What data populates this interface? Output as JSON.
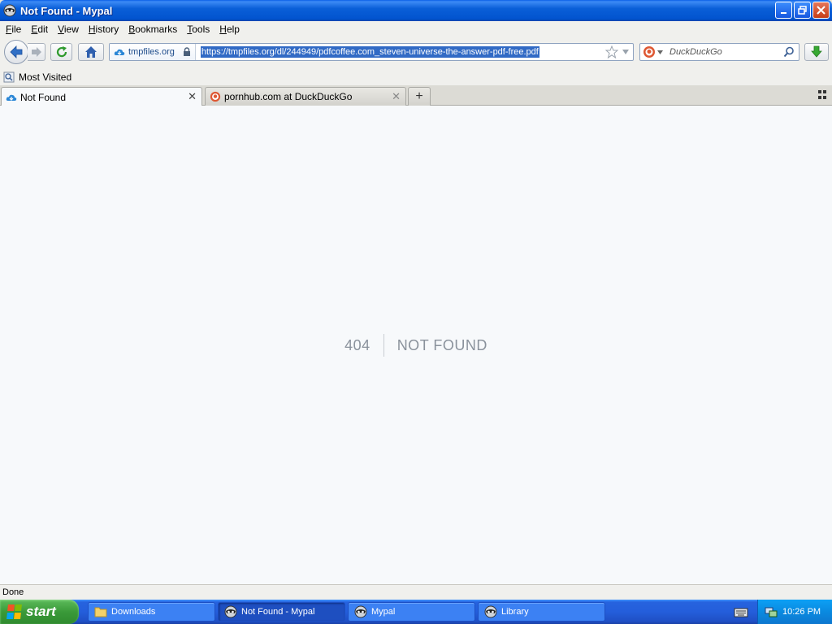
{
  "window": {
    "title": "Not Found - Mypal",
    "buttons": [
      "minimize",
      "restore",
      "close"
    ]
  },
  "menubar": [
    {
      "label": "File",
      "accel": "F",
      "rest": "ile"
    },
    {
      "label": "Edit",
      "accel": "E",
      "rest": "dit"
    },
    {
      "label": "View",
      "accel": "V",
      "rest": "iew"
    },
    {
      "label": "History",
      "accel": "H",
      "rest": "istory"
    },
    {
      "label": "Bookmarks",
      "accel": "B",
      "rest": "ookmarks"
    },
    {
      "label": "Tools",
      "accel": "T",
      "rest": "ools"
    },
    {
      "label": "Help",
      "accel": "H",
      "rest": "elp"
    }
  ],
  "navbar": {
    "identity_host": "tmpfiles.org",
    "url": "https://tmpfiles.org/dl/244949/pdfcoffee.com_steven-universe-the-answer-pdf-free.pdf",
    "search_placeholder": "DuckDuckGo"
  },
  "bookmarks": {
    "items": [
      "Most Visited"
    ]
  },
  "tabs": [
    {
      "label": "Not Found",
      "active": true
    },
    {
      "label": "pornhub.com at DuckDuckGo",
      "active": false
    }
  ],
  "content": {
    "code": "404",
    "message": "NOT FOUND"
  },
  "status": {
    "text": "Done"
  },
  "taskbar": {
    "start_label": "start",
    "tasks": [
      {
        "label": "Downloads",
        "icon": "folder-icon"
      },
      {
        "label": "Not Found - Mypal",
        "icon": "mypal-icon",
        "active": true
      },
      {
        "label": "Mypal",
        "icon": "mypal-icon"
      },
      {
        "label": "Library",
        "icon": "mypal-icon"
      }
    ],
    "clock": "10:26 PM"
  },
  "colors": {
    "titlebar": "#0a5fd8",
    "taskbar": "#245edb",
    "start": "#3a9a39",
    "url_selection": "#316ac5",
    "not_found_text": "#8a929c"
  }
}
